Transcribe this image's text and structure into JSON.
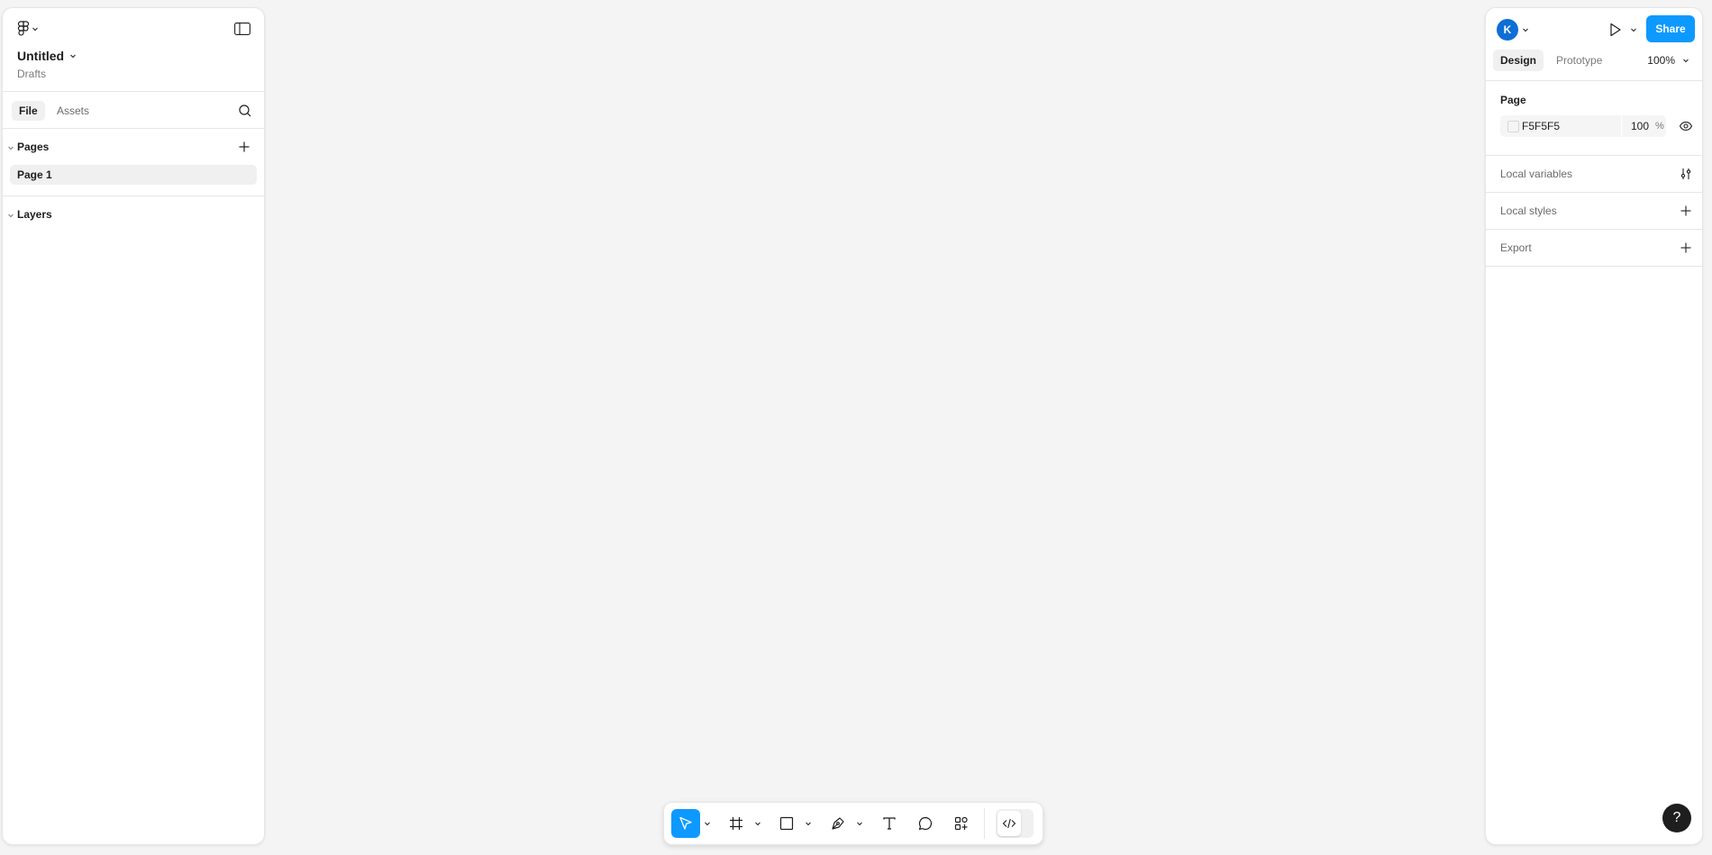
{
  "colors": {
    "accent": "#0d99ff",
    "avatar": "#0d6fd6",
    "canvas": "#F5F5F5",
    "help": "#1e1e1e"
  },
  "left_panel": {
    "menu_icon": "figma-logo-icon",
    "file_name": "Untitled",
    "file_location": "Drafts",
    "tabs": [
      {
        "label": "File",
        "active": true
      },
      {
        "label": "Assets",
        "active": false
      }
    ],
    "pages_title": "Pages",
    "pages": [
      {
        "label": "Page 1",
        "selected": true
      }
    ],
    "layers_title": "Layers"
  },
  "right_panel": {
    "avatar_initial": "K",
    "share_label": "Share",
    "tabs": [
      {
        "label": "Design",
        "active": true
      },
      {
        "label": "Prototype",
        "active": false
      }
    ],
    "zoom": "100%",
    "page_section": {
      "title": "Page",
      "fill_hex": "F5F5F5",
      "opacity": "100",
      "opacity_unit": "%"
    },
    "rows": [
      {
        "label": "Local variables",
        "action_icon": "variables-icon"
      },
      {
        "label": "Local styles",
        "action_icon": "plus-icon"
      },
      {
        "label": "Export",
        "action_icon": "plus-icon"
      }
    ]
  },
  "help_label": "?",
  "toolbar": {
    "tools": [
      {
        "name": "move-tool",
        "icon": "cursor-icon",
        "active": true
      },
      {
        "name": "frame-tool",
        "icon": "frame-icon",
        "active": false
      },
      {
        "name": "shape-tool",
        "icon": "rectangle-icon",
        "active": false
      },
      {
        "name": "pen-tool",
        "icon": "pen-icon",
        "active": false
      },
      {
        "name": "text-tool",
        "icon": "text-icon",
        "active": false
      },
      {
        "name": "comment-tool",
        "icon": "comment-icon",
        "active": false
      },
      {
        "name": "actions-tool",
        "icon": "actions-icon",
        "active": false
      }
    ],
    "dev_mode_icon": "code-icon"
  }
}
